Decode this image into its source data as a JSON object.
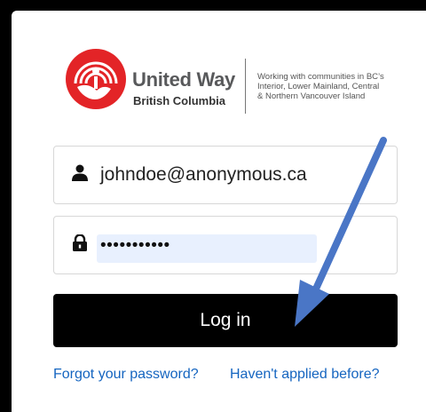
{
  "brand": {
    "name": "United Way",
    "region": "British Columbia",
    "tagline_lines": [
      "Working with communities in BC’s",
      "Interior, Lower Mainland, Central",
      "& Northern Vancouver Island"
    ],
    "colors": {
      "red": "#e32427",
      "gray": "#58595b"
    }
  },
  "login_form": {
    "email_icon": "user-icon",
    "email_value": "johndoe@anonymous.ca",
    "password_icon": "lock-icon",
    "password_masked": "•••••••••••",
    "submit_label": "Log in"
  },
  "links": {
    "forgot_password": "Forgot your password?",
    "not_applied": "Haven't applied before?"
  },
  "colors": {
    "link": "#1565c0",
    "button_bg": "#000000",
    "arrow": "#4a76c6",
    "autofill_bg": "#e8f0fe"
  }
}
